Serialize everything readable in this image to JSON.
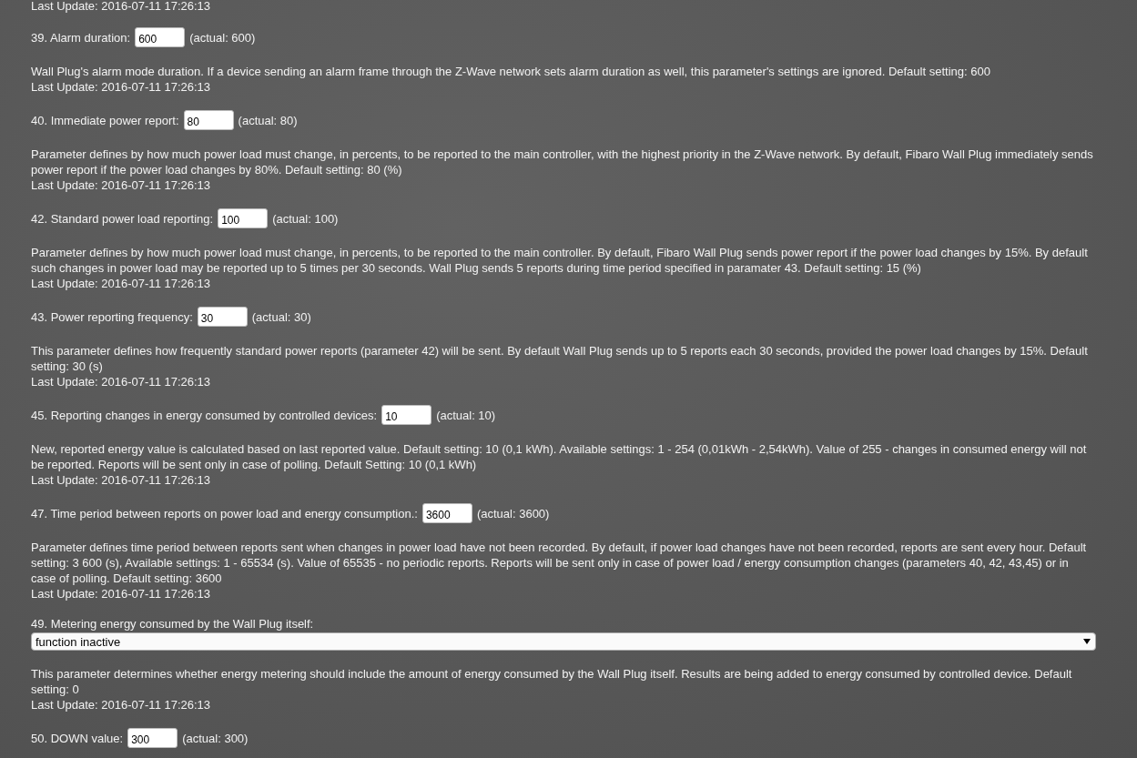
{
  "top_last_update": "Last Update: 2016-07-11 17:26:13",
  "parameters": [
    {
      "kind": "number",
      "label": "39. Alarm duration:",
      "value": "600",
      "actual": "(actual: 600)",
      "description": "Wall Plug's alarm mode duration. If a device sending an alarm frame through the Z-Wave network sets alarm duration as well, this parameter's settings are ignored. Default setting: 600",
      "last_update": "Last Update: 2016-07-11 17:26:13"
    },
    {
      "kind": "number",
      "label": "40. Immediate power report:",
      "value": "80",
      "actual": "(actual: 80)",
      "description": "Parameter defines by how much power load must change, in percents, to be reported to the main controller, with the highest priority in the Z-Wave network. By default, Fibaro Wall Plug immediately sends power report if the power load changes by 80%. Default setting: 80 (%)",
      "last_update": "Last Update: 2016-07-11 17:26:13"
    },
    {
      "kind": "number",
      "label": "42. Standard power load reporting:",
      "value": "100",
      "actual": "(actual: 100)",
      "description": "Parameter defines by how much power load must change, in percents, to be reported to the main controller. By default, Fibaro Wall Plug sends power report if the power load changes by 15%. By default such changes in power load may be reported up to 5 times per 30 seconds. Wall Plug sends 5 reports during time period specified in paramater 43. Default setting: 15 (%)",
      "last_update": "Last Update: 2016-07-11 17:26:13"
    },
    {
      "kind": "number",
      "label": "43. Power reporting frequency:",
      "value": "30",
      "actual": "(actual: 30)",
      "description": "This parameter defines how frequently standard power reports (parameter 42) will be sent. By default Wall Plug sends up to 5 reports each 30 seconds, provided the power load changes by 15%. Default setting: 30 (s)",
      "last_update": "Last Update: 2016-07-11 17:26:13"
    },
    {
      "kind": "number",
      "label": "45. Reporting changes in energy consumed by controlled devices:",
      "value": "10",
      "actual": "(actual: 10)",
      "description": "New, reported energy value is calculated based on last reported value. Default setting: 10 (0,1 kWh). Available settings: 1 - 254 (0,01kWh - 2,54kWh). Value of 255 - changes in consumed energy will not be reported. Reports will be sent only in case of polling. Default Setting: 10 (0,1 kWh)",
      "last_update": "Last Update: 2016-07-11 17:26:13"
    },
    {
      "kind": "number",
      "label": "47. Time period between reports on power load and energy consumption.:",
      "value": "3600",
      "actual": "(actual: 3600)",
      "description": "Parameter defines time period between reports sent when changes in power load have not been recorded. By default, if power load changes have not been recorded, reports are sent every hour. Default setting: 3 600 (s), Available settings: 1 - 65534 (s). Value of 65535 - no periodic reports. Reports will be sent only in case of power load / energy consumption changes (parameters 40, 42, 43,45) or in case of polling. Default setting: 3600",
      "last_update": "Last Update: 2016-07-11 17:26:13"
    },
    {
      "kind": "select",
      "label": "49. Metering energy consumed by the Wall Plug itself:",
      "value": "function inactive",
      "description": "This parameter determines whether energy metering should include the amount of energy consumed by the Wall Plug itself. Results are being added to energy consumed by controlled device. Default setting: 0",
      "last_update": "Last Update: 2016-07-11 17:26:13"
    },
    {
      "kind": "number",
      "label": "50. DOWN value:",
      "value": "300",
      "actual": "(actual: 300)"
    }
  ]
}
